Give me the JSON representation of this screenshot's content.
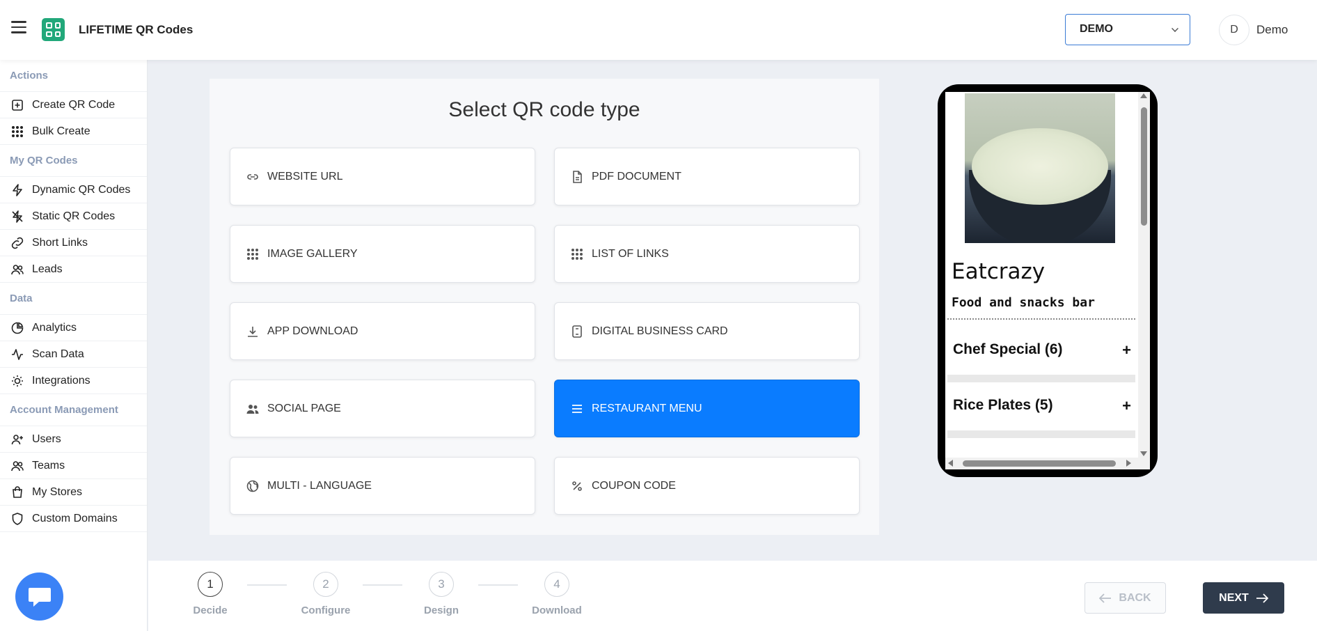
{
  "header": {
    "app_title": "LIFETIME QR Codes",
    "workspace_select": "DEMO",
    "avatar_initial": "D",
    "user_name": "Demo"
  },
  "sidebar": {
    "sections": [
      {
        "title": "Actions",
        "items": [
          {
            "label": "Create QR Code",
            "icon": "plus-square-icon"
          },
          {
            "label": "Bulk Create",
            "icon": "grid-icon"
          }
        ]
      },
      {
        "title": "My QR Codes",
        "items": [
          {
            "label": "Dynamic QR Codes",
            "icon": "bolt-icon"
          },
          {
            "label": "Static QR Codes",
            "icon": "bolt-off-icon"
          },
          {
            "label": "Short Links",
            "icon": "link-icon"
          },
          {
            "label": "Leads",
            "icon": "users-icon"
          }
        ]
      },
      {
        "title": "Data",
        "items": [
          {
            "label": "Analytics",
            "icon": "pie-chart-icon"
          },
          {
            "label": "Scan Data",
            "icon": "activity-icon"
          },
          {
            "label": "Integrations",
            "icon": "bulb-icon"
          }
        ]
      },
      {
        "title": "Account Management",
        "items": [
          {
            "label": "Users",
            "icon": "user-plus-icon"
          },
          {
            "label": "Teams",
            "icon": "team-icon"
          },
          {
            "label": "My Stores",
            "icon": "shopping-bag-icon"
          },
          {
            "label": "Custom Domains",
            "icon": "shield-icon"
          }
        ]
      }
    ]
  },
  "main": {
    "title": "Select QR code type",
    "types": [
      {
        "label": "WEBSITE URL",
        "icon": "link-icon"
      },
      {
        "label": "PDF DOCUMENT",
        "icon": "file-icon"
      },
      {
        "label": "IMAGE GALLERY",
        "icon": "grid-icon"
      },
      {
        "label": "LIST OF LINKS",
        "icon": "grid-icon"
      },
      {
        "label": "APP DOWNLOAD",
        "icon": "download-icon"
      },
      {
        "label": "DIGITAL BUSINESS CARD",
        "icon": "card-icon"
      },
      {
        "label": "SOCIAL PAGE",
        "icon": "people-icon"
      },
      {
        "label": "RESTAURANT MENU",
        "icon": "list-icon"
      },
      {
        "label": "MULTI - LANGUAGE",
        "icon": "globe-icon"
      },
      {
        "label": "COUPON CODE",
        "icon": "percent-icon"
      }
    ],
    "selected": "RESTAURANT MENU"
  },
  "preview": {
    "restaurant_name": "Eatcrazy",
    "subtitle": "Food and snacks bar",
    "sections": [
      {
        "label": "Chef Special (6)",
        "toggle": "+"
      },
      {
        "label": "Rice Plates (5)",
        "toggle": "+"
      }
    ]
  },
  "footer": {
    "steps": [
      {
        "number": "1",
        "label": "Decide"
      },
      {
        "number": "2",
        "label": "Configure"
      },
      {
        "number": "3",
        "label": "Design"
      },
      {
        "number": "4",
        "label": "Download"
      }
    ],
    "current_step": 1,
    "back_label": "BACK",
    "next_label": "NEXT"
  },
  "colors": {
    "accent": "#0a7cff",
    "brand_green": "#22a87a",
    "dark_button": "#2f3b4c"
  }
}
